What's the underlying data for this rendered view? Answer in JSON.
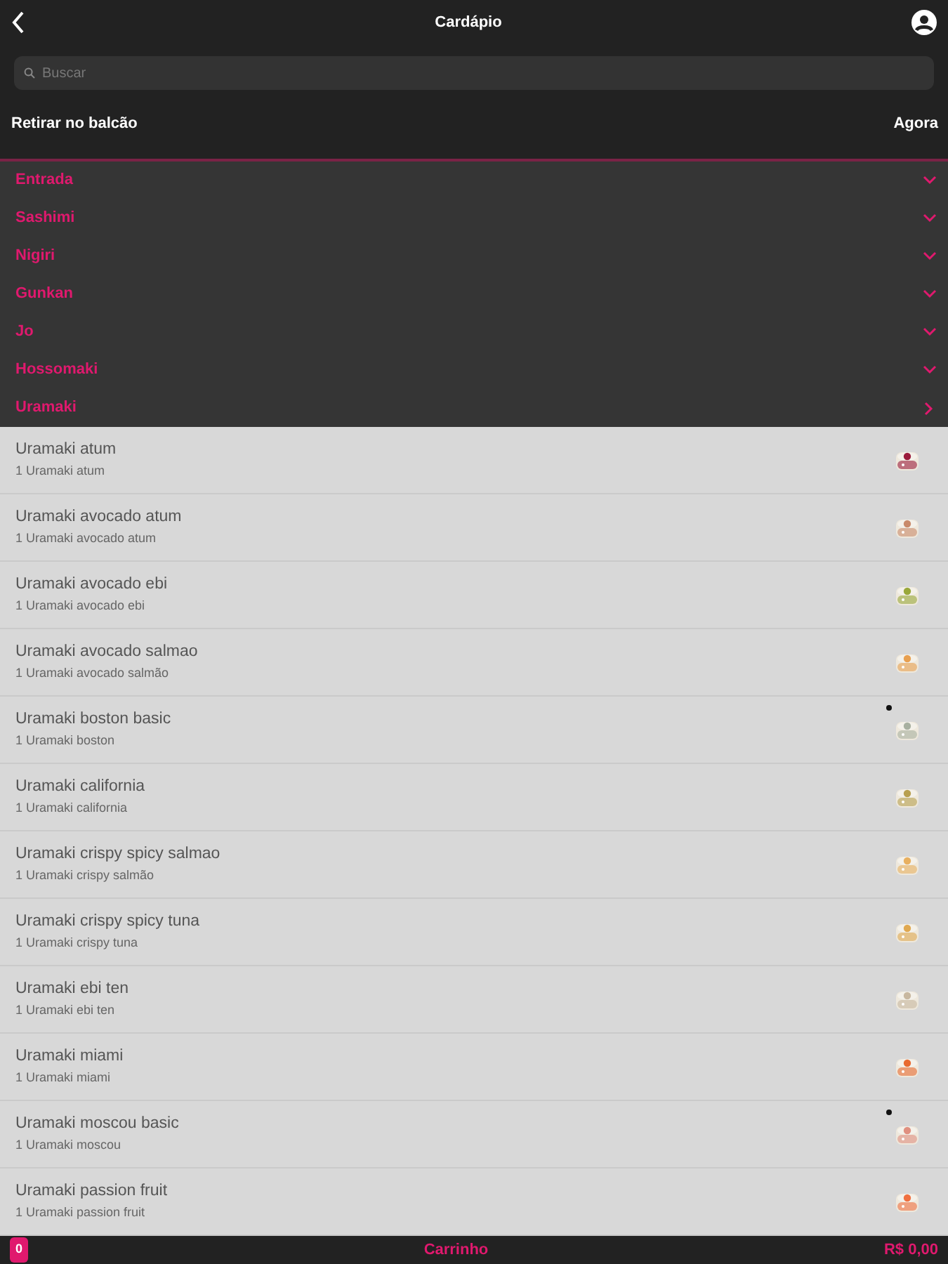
{
  "header": {
    "title": "Cardápio"
  },
  "search": {
    "placeholder": "Buscar"
  },
  "pickup": {
    "label": "Retirar no balcão",
    "time": "Agora"
  },
  "categories": [
    {
      "label": "Entrada",
      "expanded": false
    },
    {
      "label": "Sashimi",
      "expanded": false
    },
    {
      "label": "Nigiri",
      "expanded": false
    },
    {
      "label": "Gunkan",
      "expanded": false
    },
    {
      "label": "Jo",
      "expanded": false
    },
    {
      "label": "Hossomaki",
      "expanded": false
    },
    {
      "label": "Uramaki",
      "expanded": true
    }
  ],
  "items": [
    {
      "name": "Uramaki atum",
      "description": "1 Uramaki atum",
      "dot": false
    },
    {
      "name": "Uramaki avocado atum",
      "description": "1 Uramaki avocado atum",
      "dot": false
    },
    {
      "name": "Uramaki avocado ebi",
      "description": "1 Uramaki avocado ebi",
      "dot": false
    },
    {
      "name": "Uramaki avocado salmao",
      "description": "1 Uramaki avocado salmão",
      "dot": false
    },
    {
      "name": "Uramaki boston basic",
      "description": "1 Uramaki boston",
      "dot": true
    },
    {
      "name": "Uramaki california",
      "description": "1 Uramaki california",
      "dot": false
    },
    {
      "name": "Uramaki crispy spicy salmao",
      "description": "1 Uramaki crispy salmão",
      "dot": false
    },
    {
      "name": "Uramaki crispy spicy tuna",
      "description": "1 Uramaki crispy tuna",
      "dot": false
    },
    {
      "name": "Uramaki ebi ten",
      "description": "1 Uramaki ebi ten",
      "dot": false
    },
    {
      "name": "Uramaki miami",
      "description": "1 Uramaki miami",
      "dot": false
    },
    {
      "name": "Uramaki moscou basic",
      "description": "1 Uramaki moscou",
      "dot": true
    },
    {
      "name": "Uramaki passion fruit",
      "description": "1 Uramaki passion fruit",
      "dot": false
    }
  ],
  "footer": {
    "count": "0",
    "label": "Carrinho",
    "total": "R$ 0,00"
  }
}
